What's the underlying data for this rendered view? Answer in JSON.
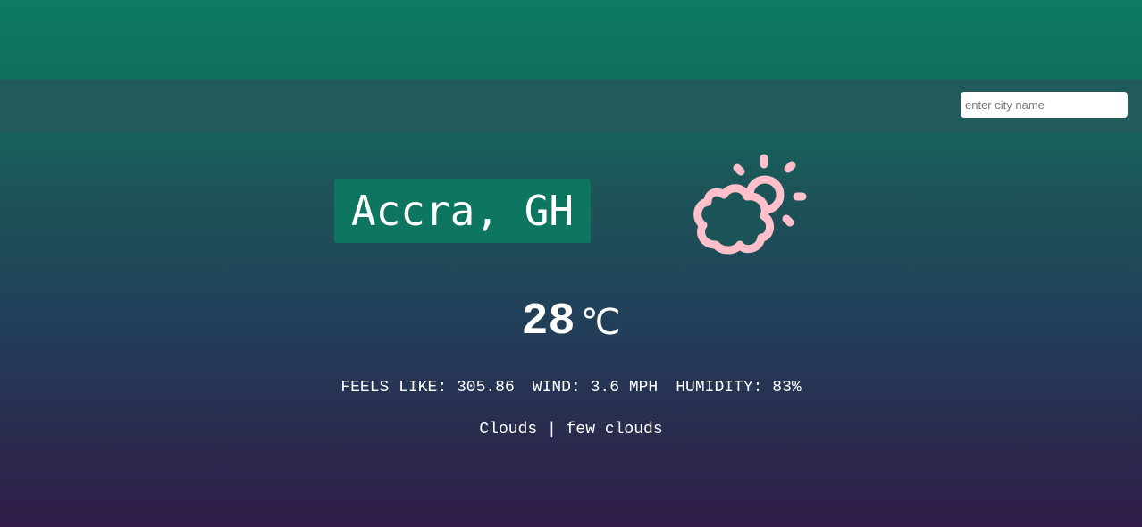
{
  "search": {
    "placeholder": "enter city name",
    "value": ""
  },
  "location": {
    "city": "Accra, GH"
  },
  "weather": {
    "icon": "partly-cloudy-icon",
    "icon_color": "#ffc0cb",
    "temperature": "28",
    "unit": "℃",
    "feels_like_label": "FEELS LIKE:",
    "feels_like_value": "305.86",
    "wind_label": "WIND:",
    "wind_value": "3.6 MPH",
    "humidity_label": "HUMIDITY:",
    "humidity_value": "83%",
    "condition_main": "Clouds",
    "condition_separator": "|",
    "condition_description": "few clouds"
  },
  "colors": {
    "gradient_top": "#0e7a64",
    "gradient_bottom": "#301d47",
    "search_bar_bg": "#225a5c",
    "city_box_bg": "#0e7560"
  }
}
